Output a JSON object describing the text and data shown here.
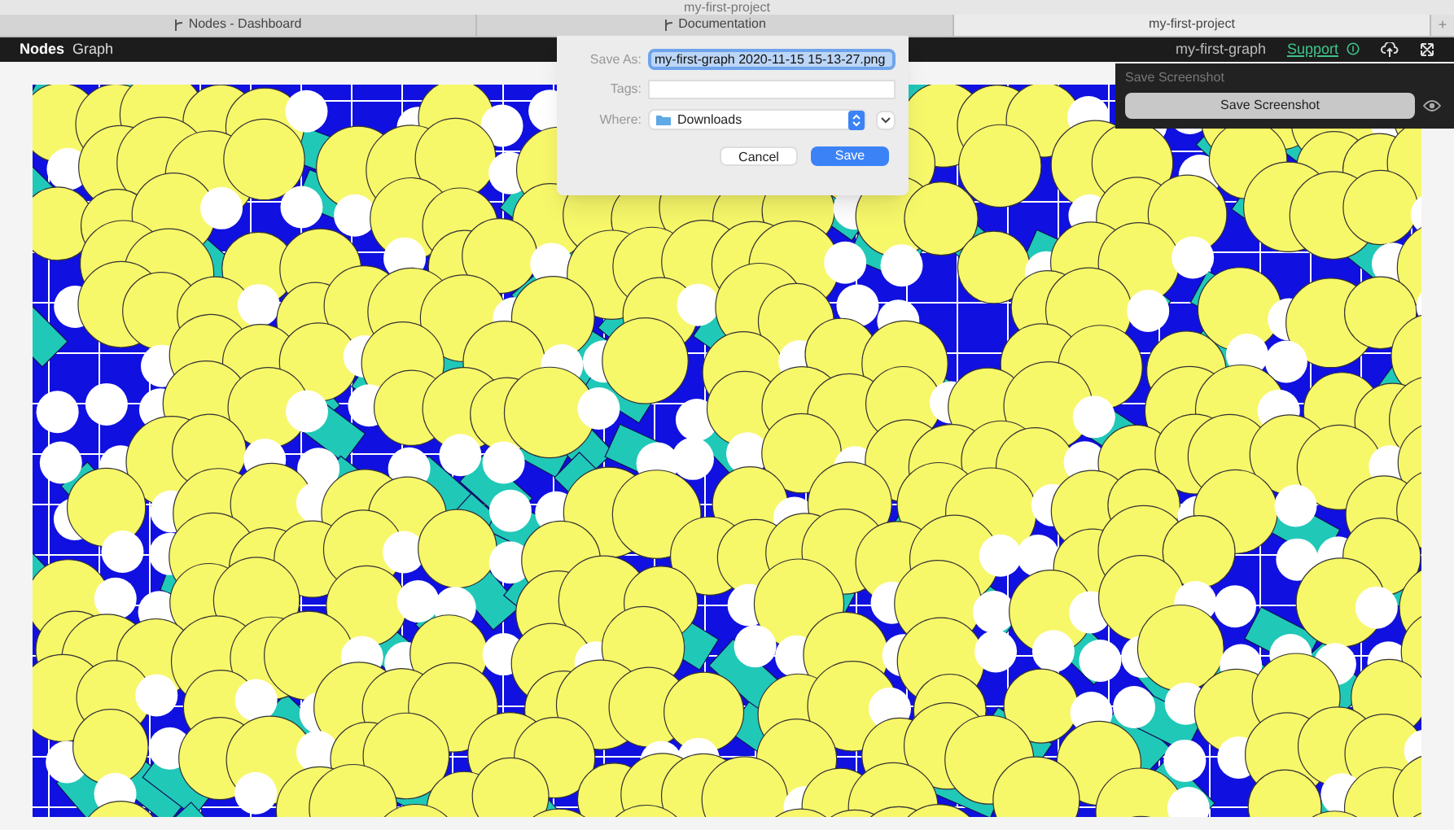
{
  "window": {
    "title": "my-first-project"
  },
  "tabs": [
    {
      "label": "Nodes - Dashboard",
      "selected": false
    },
    {
      "label": "Documentation",
      "selected": false
    },
    {
      "label": "my-first-project",
      "selected": true
    }
  ],
  "new_tab": "+",
  "app_bar": {
    "brand": "Nodes",
    "menu": "Graph",
    "graph_name": "my-first-graph",
    "support_link": "Support"
  },
  "save_dialog": {
    "save_as_label": "Save As:",
    "file_name": "my-first-graph 2020-11-15 15-13-27.png",
    "tags_label": "Tags:",
    "where_label": "Where:",
    "where_value": "Downloads",
    "buttons": [
      {
        "label": "Cancel",
        "kind": "secondary"
      },
      {
        "label": "Save",
        "kind": "primary"
      }
    ]
  },
  "screenshot_panel": {
    "title": "Save Screenshot",
    "button": "Save Screenshot"
  }
}
